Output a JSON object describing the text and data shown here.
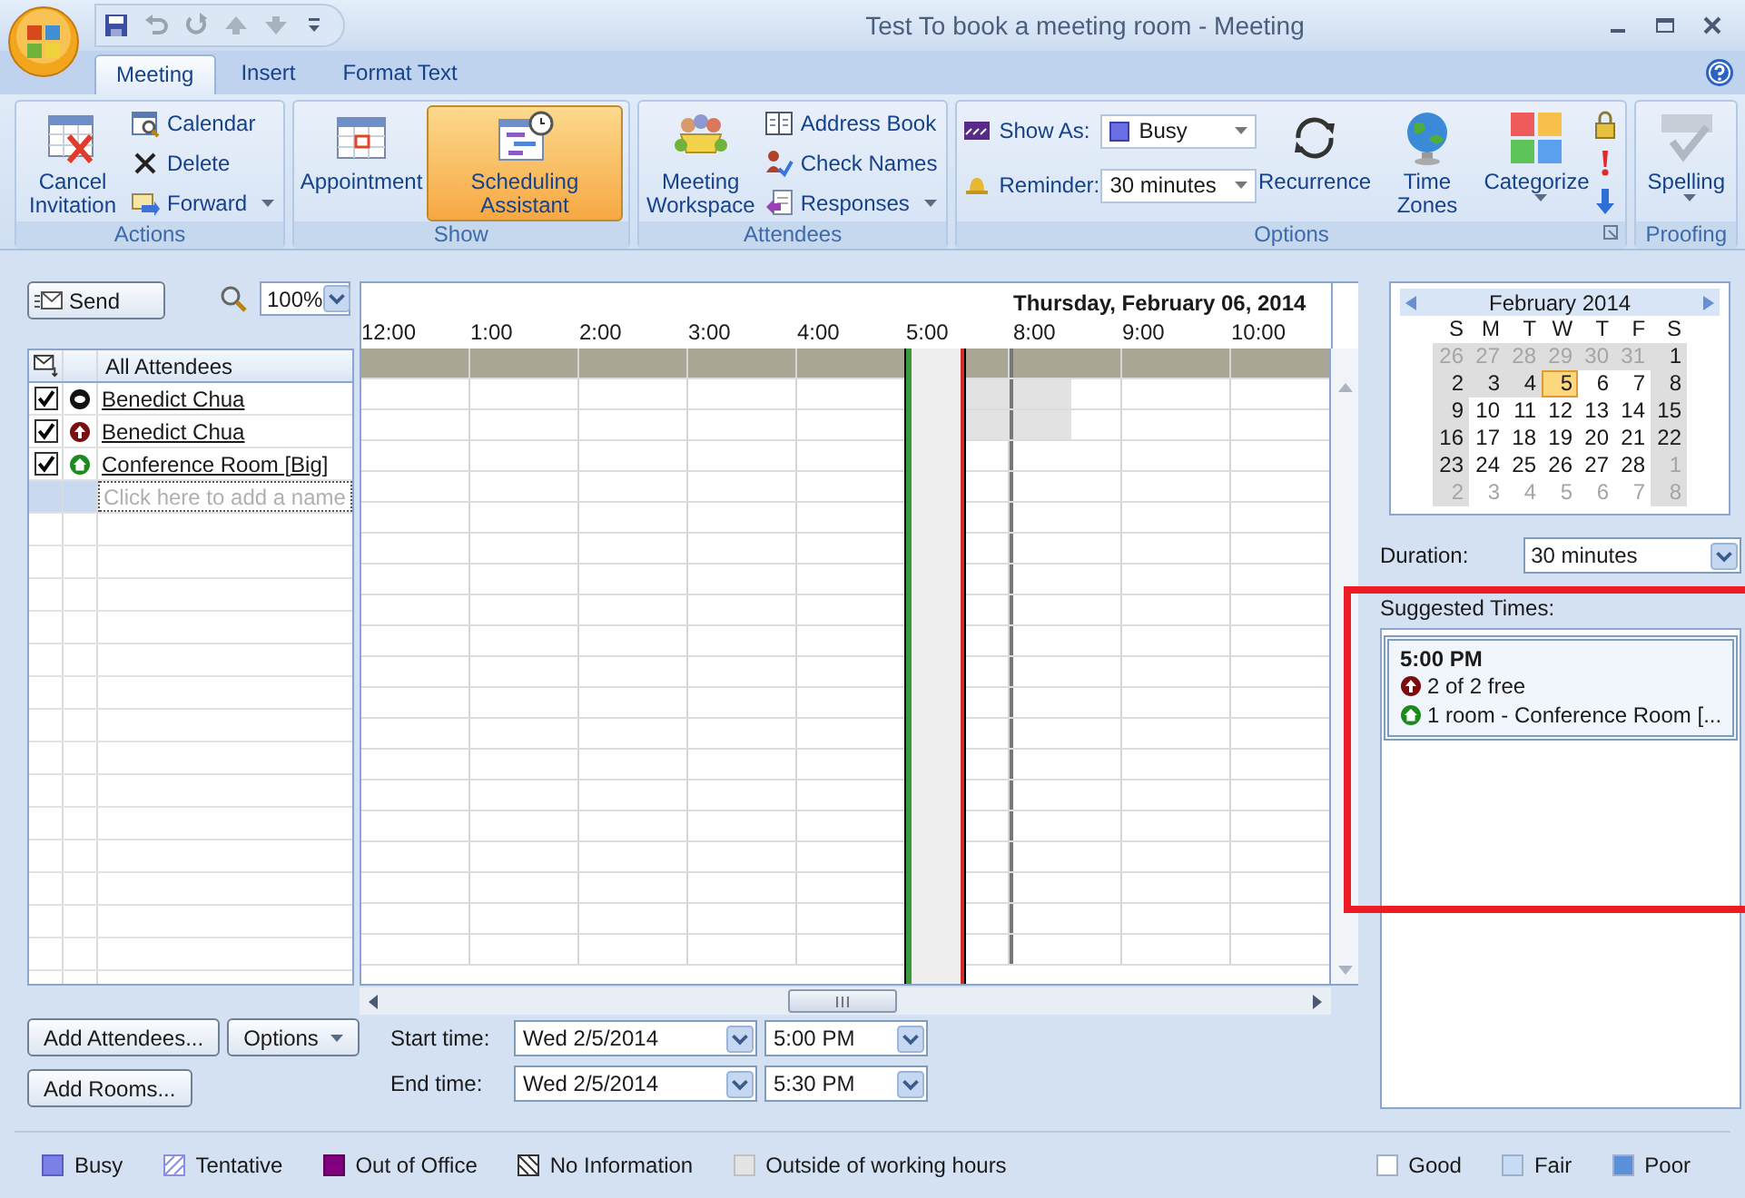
{
  "window": {
    "title": "Test To book a meeting room - Meeting"
  },
  "tabs": [
    {
      "label": "Meeting",
      "selected": true
    },
    {
      "label": "Insert",
      "selected": false
    },
    {
      "label": "Format Text",
      "selected": false
    }
  ],
  "ribbon": {
    "groups": [
      {
        "label": "Actions",
        "large": [
          {
            "label": "Cancel Invitation",
            "menu": false
          }
        ],
        "small": [
          {
            "label": "Calendar",
            "menu": false
          },
          {
            "label": "Delete",
            "menu": false
          },
          {
            "label": "Forward",
            "menu": true
          }
        ]
      },
      {
        "label": "Show",
        "large": [
          {
            "label": "Appointment",
            "selected": false,
            "menu": false
          },
          {
            "label": "Scheduling Assistant",
            "selected": true,
            "menu": false
          }
        ]
      },
      {
        "label": "Attendees",
        "large": [
          {
            "label": "Meeting Workspace",
            "menu": false
          }
        ],
        "small": [
          {
            "label": "Address Book",
            "menu": false
          },
          {
            "label": "Check Names",
            "menu": false
          },
          {
            "label": "Responses",
            "menu": true
          }
        ]
      },
      {
        "label": "Options",
        "fields": [
          {
            "label": "Show As:",
            "value": "Busy"
          },
          {
            "label": "Reminder:",
            "value": "30 minutes"
          }
        ],
        "large": [
          {
            "label": "Recurrence",
            "menu": false
          },
          {
            "label": "Time Zones",
            "menu": false
          },
          {
            "label": "Categorize",
            "menu": true
          }
        ]
      },
      {
        "label": "Proofing",
        "large": [
          {
            "label": "Spelling",
            "menu": true
          }
        ]
      }
    ]
  },
  "toolbar": {
    "send": "Send",
    "zoom": "100%"
  },
  "attendee_header": "All Attendees",
  "attendees": [
    {
      "name": "Benedict Chua",
      "checked": true,
      "kind": "organizer",
      "outside_hours": true
    },
    {
      "name": "Benedict Chua",
      "checked": true,
      "kind": "required",
      "outside_hours": true
    },
    {
      "name": "Conference Room [Big]",
      "checked": true,
      "kind": "resource",
      "outside_hours": false
    }
  ],
  "add_name": {
    "placeholder": "Click here to add a name"
  },
  "schedule": {
    "hours": [
      "12:00",
      "1:00",
      "2:00",
      "3:00",
      "4:00",
      "5:00"
    ],
    "next_day": {
      "date": "Thursday, February 06, 2014",
      "hours": [
        "8:00",
        "9:00",
        "10:00"
      ]
    }
  },
  "buttons": {
    "add_attendees": "Add Attendees...",
    "options": "Options",
    "add_rooms": "Add Rooms..."
  },
  "times": [
    {
      "label": "Start time:",
      "date": "Wed 2/5/2014",
      "time": "5:00 PM"
    },
    {
      "label": "End time:",
      "date": "Wed 2/5/2014",
      "time": "5:30 PM"
    }
  ],
  "calendar": {
    "month": "February 2014",
    "weekdays": [
      "S",
      "M",
      "T",
      "W",
      "T",
      "F",
      "S"
    ],
    "days": [
      {
        "d": "26",
        "other_month": true,
        "shaded": true,
        "selected": false
      },
      {
        "d": "27",
        "other_month": true,
        "shaded": true,
        "selected": false
      },
      {
        "d": "28",
        "other_month": true,
        "shaded": true,
        "selected": false
      },
      {
        "d": "29",
        "other_month": true,
        "shaded": true,
        "selected": false
      },
      {
        "d": "30",
        "other_month": true,
        "shaded": true,
        "selected": false
      },
      {
        "d": "31",
        "other_month": true,
        "shaded": true,
        "selected": false
      },
      {
        "d": "1",
        "other_month": false,
        "shaded": true,
        "selected": false
      },
      {
        "d": "2",
        "other_month": false,
        "shaded": true,
        "selected": false
      },
      {
        "d": "3",
        "other_month": false,
        "shaded": true,
        "selected": false
      },
      {
        "d": "4",
        "other_month": false,
        "shaded": true,
        "selected": false
      },
      {
        "d": "5",
        "other_month": false,
        "shaded": false,
        "selected": true
      },
      {
        "d": "6",
        "other_month": false,
        "shaded": false,
        "selected": false
      },
      {
        "d": "7",
        "other_month": false,
        "shaded": false,
        "selected": false
      },
      {
        "d": "8",
        "other_month": false,
        "shaded": true,
        "selected": false
      },
      {
        "d": "9",
        "other_month": false,
        "shaded": true,
        "selected": false
      },
      {
        "d": "10",
        "other_month": false,
        "shaded": false,
        "selected": false
      },
      {
        "d": "11",
        "other_month": false,
        "shaded": false,
        "selected": false
      },
      {
        "d": "12",
        "other_month": false,
        "shaded": false,
        "selected": false
      },
      {
        "d": "13",
        "other_month": false,
        "shaded": false,
        "selected": false
      },
      {
        "d": "14",
        "other_month": false,
        "shaded": false,
        "selected": false
      },
      {
        "d": "15",
        "other_month": false,
        "shaded": true,
        "selected": false
      },
      {
        "d": "16",
        "other_month": false,
        "shaded": true,
        "selected": false
      },
      {
        "d": "17",
        "other_month": false,
        "shaded": false,
        "selected": false
      },
      {
        "d": "18",
        "other_month": false,
        "shaded": false,
        "selected": false
      },
      {
        "d": "19",
        "other_month": false,
        "shaded": false,
        "selected": false
      },
      {
        "d": "20",
        "other_month": false,
        "shaded": false,
        "selected": false
      },
      {
        "d": "21",
        "other_month": false,
        "shaded": false,
        "selected": false
      },
      {
        "d": "22",
        "other_month": false,
        "shaded": true,
        "selected": false
      },
      {
        "d": "23",
        "other_month": false,
        "shaded": true,
        "selected": false
      },
      {
        "d": "24",
        "other_month": false,
        "shaded": false,
        "selected": false
      },
      {
        "d": "25",
        "other_month": false,
        "shaded": false,
        "selected": false
      },
      {
        "d": "26",
        "other_month": false,
        "shaded": false,
        "selected": false
      },
      {
        "d": "27",
        "other_month": false,
        "shaded": false,
        "selected": false
      },
      {
        "d": "28",
        "other_month": false,
        "shaded": false,
        "selected": false
      },
      {
        "d": "1",
        "other_month": true,
        "shaded": true,
        "selected": false
      },
      {
        "d": "2",
        "other_month": true,
        "shaded": true,
        "selected": false
      },
      {
        "d": "3",
        "other_month": true,
        "shaded": false,
        "selected": false
      },
      {
        "d": "4",
        "other_month": true,
        "shaded": false,
        "selected": false
      },
      {
        "d": "5",
        "other_month": true,
        "shaded": false,
        "selected": false
      },
      {
        "d": "6",
        "other_month": true,
        "shaded": false,
        "selected": false
      },
      {
        "d": "7",
        "other_month": true,
        "shaded": false,
        "selected": false
      },
      {
        "d": "8",
        "other_month": true,
        "shaded": true,
        "selected": false
      }
    ]
  },
  "duration": {
    "label": "Duration:",
    "value": "30 minutes"
  },
  "suggested": {
    "label": "Suggested Times:",
    "highlighted": true,
    "items": [
      {
        "time": "5:00 PM",
        "selected": true,
        "lines": [
          {
            "kind": "required",
            "text": "2 of 2 free"
          },
          {
            "kind": "resource",
            "text": "1 room - Conference Room [..."
          }
        ]
      }
    ]
  },
  "legend": [
    {
      "kind": "busy",
      "label": "Busy"
    },
    {
      "kind": "tentative",
      "label": "Tentative"
    },
    {
      "kind": "oof",
      "label": "Out of Office"
    },
    {
      "kind": "noinfo",
      "label": "No Information"
    },
    {
      "kind": "outside",
      "label": "Outside of working hours"
    }
  ],
  "quality_legend": [
    {
      "label": "Good",
      "color": "#ffffff"
    },
    {
      "label": "Fair",
      "color": "#c6dcf6"
    },
    {
      "label": "Poor",
      "color": "#5b8fd9"
    }
  ]
}
